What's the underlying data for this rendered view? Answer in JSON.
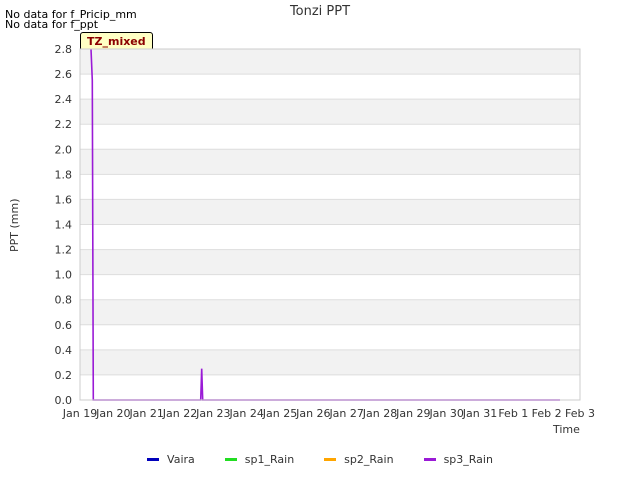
{
  "notes": [
    "No data for f_Pricip_mm",
    "No data for f_ppt"
  ],
  "badge": "TZ_mixed",
  "chart_data": {
    "type": "line",
    "title": "Tonzi PPT",
    "xlabel": "Time",
    "ylabel": "PPT (mm)",
    "ylim": [
      0,
      2.8
    ],
    "yticks": [
      "0.0",
      "0.2",
      "0.4",
      "0.6",
      "0.8",
      "1.0",
      "1.2",
      "1.4",
      "1.6",
      "1.8",
      "2.0",
      "2.2",
      "2.4",
      "2.6",
      "2.8"
    ],
    "xlim": [
      0,
      15
    ],
    "xtick_labels": [
      "Jan 19",
      "Jan 20",
      "Jan 21",
      "Jan 22",
      "Jan 23",
      "Jan 24",
      "Jan 25",
      "Jan 26",
      "Jan 27",
      "Jan 28",
      "Jan 29",
      "Jan 30",
      "Jan 31",
      "Feb 1",
      "Feb 2",
      "Feb 3"
    ],
    "grid": "horizontal bands",
    "legend_position": "bottom",
    "series": [
      {
        "name": "Vaira",
        "color": "#0000bb",
        "x": [],
        "y": []
      },
      {
        "name": "sp1_Rain",
        "color": "#22dd22",
        "x": [],
        "y": []
      },
      {
        "name": "sp2_Rain",
        "color": "#ffa500",
        "x": [],
        "y": []
      },
      {
        "name": "sp3_Rain",
        "color": "#9a1ad6",
        "x": [
          0.33,
          0.37,
          0.4,
          0.43,
          3.62,
          3.65,
          3.68,
          3.72,
          14.4
        ],
        "y": [
          2.8,
          2.55,
          0.0,
          0.0,
          0.0,
          0.25,
          0.0,
          0.0,
          0.0
        ]
      }
    ]
  }
}
